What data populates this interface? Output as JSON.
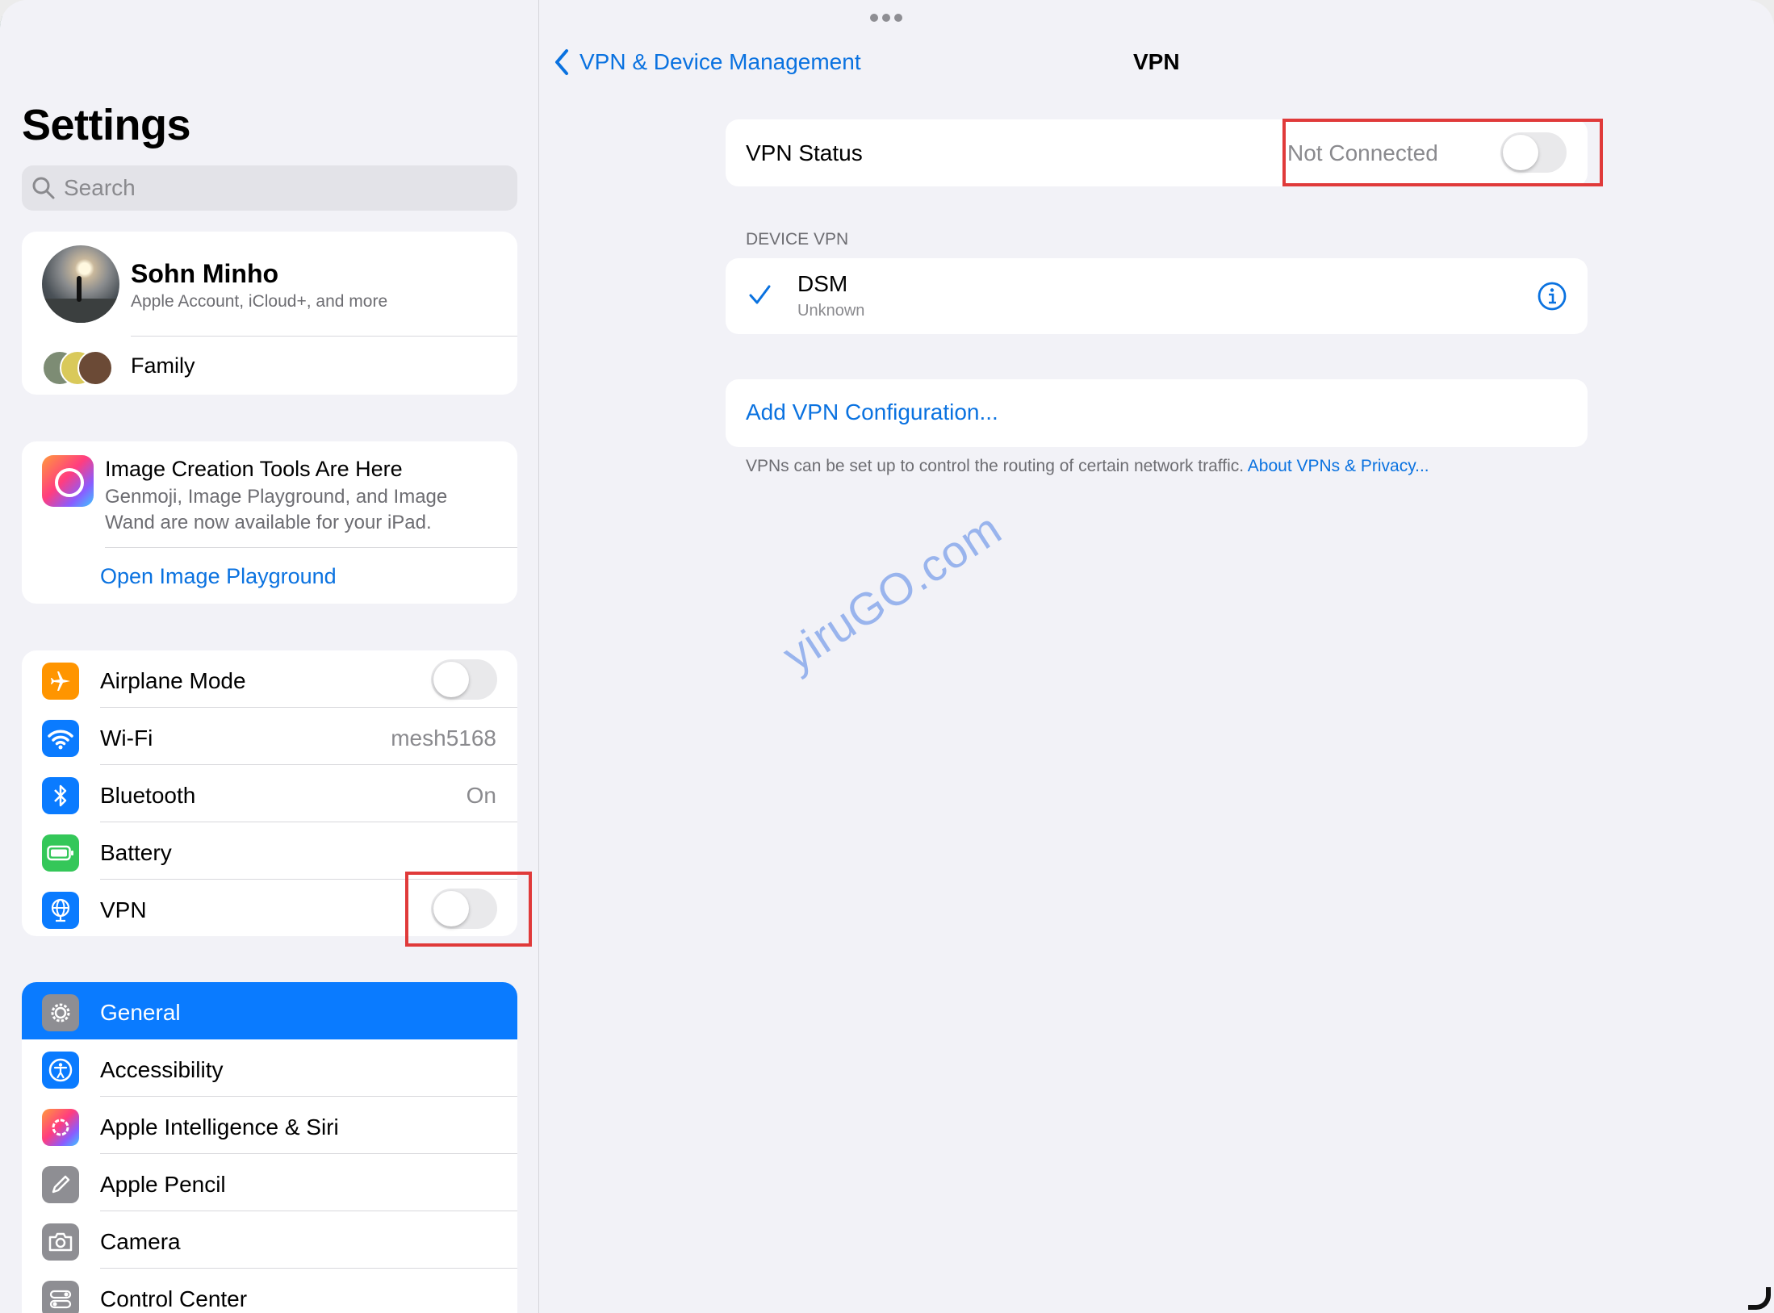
{
  "sidebar": {
    "title": "Settings",
    "search_placeholder": "Search",
    "account": {
      "name": "Sohn Minho",
      "subtitle": "Apple Account, iCloud+, and more",
      "family_label": "Family"
    },
    "promo": {
      "title": "Image Creation Tools Are Here",
      "body": "Genmoji, Image Playground, and Image Wand are now available for your iPad.",
      "link": "Open Image Playground"
    },
    "connectivity": [
      {
        "label": "Airplane Mode",
        "icon": "airplane-icon",
        "color": "#ff9500",
        "toggle": false
      },
      {
        "label": "Wi-Fi",
        "icon": "wifi-icon",
        "color": "#0a7bff",
        "value": "mesh5168"
      },
      {
        "label": "Bluetooth",
        "icon": "bluetooth-icon",
        "color": "#0a7bff",
        "value": "On"
      },
      {
        "label": "Battery",
        "icon": "battery-icon",
        "color": "#34c759"
      },
      {
        "label": "VPN",
        "icon": "vpn-globe-icon",
        "color": "#0a7bff",
        "toggle": false
      }
    ],
    "general_group": [
      {
        "label": "General",
        "icon": "gear-icon",
        "color": "#8e8e93",
        "selected": true
      },
      {
        "label": "Accessibility",
        "icon": "accessibility-icon",
        "color": "#0a7bff"
      },
      {
        "label": "Apple Intelligence & Siri",
        "icon": "apple-intelligence-icon",
        "color": "#ff6b6b"
      },
      {
        "label": "Apple Pencil",
        "icon": "pencil-icon",
        "color": "#8e8e93"
      },
      {
        "label": "Camera",
        "icon": "camera-icon",
        "color": "#8e8e93"
      },
      {
        "label": "Control Center",
        "icon": "control-center-icon",
        "color": "#8e8e93"
      }
    ]
  },
  "detail": {
    "back_label": "VPN & Device Management",
    "title": "VPN",
    "status_label": "VPN Status",
    "status_value": "Not Connected",
    "status_toggle": false,
    "section_header": "DEVICE VPN",
    "profile": {
      "name": "DSM",
      "status": "Unknown",
      "selected": true
    },
    "add_config": "Add VPN Configuration...",
    "footer_text": "VPNs can be set up to control the routing of certain network traffic. ",
    "footer_link": "About VPNs & Privacy..."
  },
  "watermark": "yiruGO.com",
  "colors": {
    "accent": "#0a72e0",
    "selection": "#0a7bff",
    "highlight_box": "#e03a3a"
  }
}
